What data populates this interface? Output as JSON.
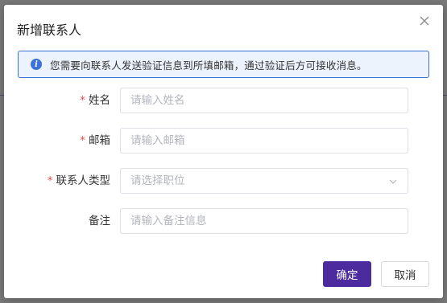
{
  "dialog": {
    "title": "新增联系人",
    "alert_text": "您需要向联系人发送验证信息到所填邮箱，通过验证后方可接收消息。"
  },
  "form": {
    "name": {
      "label": "姓名",
      "placeholder": "请输入姓名",
      "required": "*"
    },
    "email": {
      "label": "邮箱",
      "placeholder": "请输入邮箱",
      "required": "*"
    },
    "type": {
      "label": "联系人类型",
      "placeholder": "请选择职位",
      "required": "*"
    },
    "note": {
      "label": "备注",
      "placeholder": "请输入备注信息"
    }
  },
  "buttons": {
    "confirm": "确定",
    "cancel": "取消"
  },
  "colors": {
    "primary": "#4b2b9e",
    "info": "#3a72d8",
    "required": "#e34d4d"
  },
  "icons": [
    "close-icon",
    "info-icon",
    "chevron-down-icon"
  ]
}
